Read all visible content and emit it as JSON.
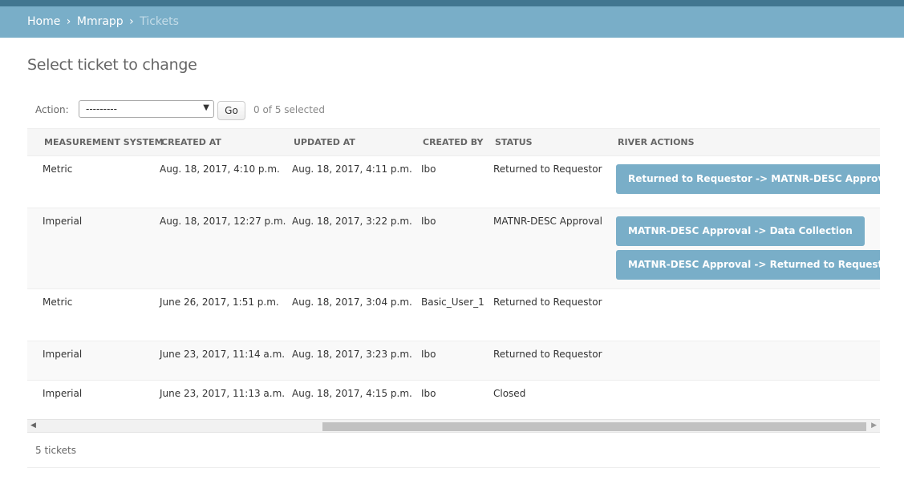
{
  "breadcrumbs": {
    "home": "Home",
    "sep1": "›",
    "app": "Mmrapp",
    "sep2": "›",
    "current": "Tickets"
  },
  "page": {
    "title": "Select ticket to change"
  },
  "actions": {
    "label": "Action:",
    "selected_option": "---------",
    "go_label": "Go",
    "selection_count": "0 of 5 selected"
  },
  "table": {
    "headers": {
      "measurement_system": "Measurement System",
      "created_at": "Created At",
      "updated_at": "Updated At",
      "created_by": "Created By",
      "status": "Status",
      "river_actions": "River Actions"
    },
    "rows": [
      {
        "measurement_system": "Metric",
        "created_at": "Aug. 18, 2017, 4:10 p.m.",
        "updated_at": "Aug. 18, 2017, 4:11 p.m.",
        "created_by": "Ibo",
        "status": "Returned to Requestor",
        "actions": [
          "Returned to Requestor -> MATNR-DESC Approval"
        ]
      },
      {
        "measurement_system": "Imperial",
        "created_at": "Aug. 18, 2017, 12:27 p.m.",
        "updated_at": "Aug. 18, 2017, 3:22 p.m.",
        "created_by": "Ibo",
        "status": "MATNR-DESC Approval",
        "actions": [
          "MATNR-DESC Approval -> Data Collection",
          "MATNR-DESC Approval -> Returned to Requestor"
        ]
      },
      {
        "measurement_system": "Metric",
        "created_at": "June 26, 2017, 1:51 p.m.",
        "updated_at": "Aug. 18, 2017, 3:04 p.m.",
        "created_by": "Basic_User_1",
        "status": "Returned to Requestor",
        "actions": []
      },
      {
        "measurement_system": "Imperial",
        "created_at": "June 23, 2017, 11:14 a.m.",
        "updated_at": "Aug. 18, 2017, 3:23 p.m.",
        "created_by": "Ibo",
        "status": "Returned to Requestor",
        "actions": []
      },
      {
        "measurement_system": "Imperial",
        "created_at": "June 23, 2017, 11:13 a.m.",
        "updated_at": "Aug. 18, 2017, 4:15 p.m.",
        "created_by": "Ibo",
        "status": "Closed",
        "actions": []
      }
    ]
  },
  "footer": {
    "count": "5 tickets"
  },
  "colors": {
    "header_dark": "#417690",
    "breadcrumb_bg": "#79aec8",
    "button_bg": "#79aec8"
  },
  "icons": {
    "select_arrow": "caret-down-icon",
    "scroll_left": "arrow-left-icon",
    "scroll_right": "arrow-right-icon"
  }
}
